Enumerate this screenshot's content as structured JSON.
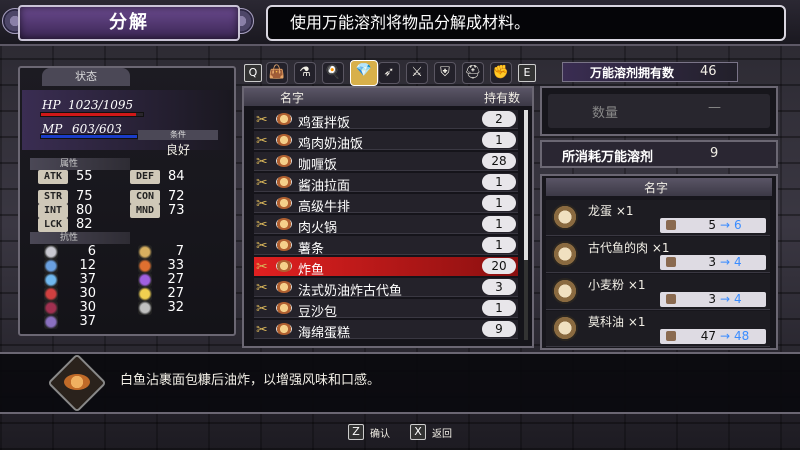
{
  "header": {
    "title": "分解",
    "hint": "使用万能溶剂将物品分解成材料。"
  },
  "status": {
    "tab": "状态",
    "hp_label": "HP",
    "hp_value": "1023/1095",
    "hp_fill": 0.93,
    "mp_label": "MP",
    "mp_value": "603/603",
    "mp_fill": 1.0,
    "condition_label": "条件",
    "condition_value": "良好",
    "attr_header": "属性",
    "stats": [
      {
        "label": "ATK",
        "value": "55"
      },
      {
        "label": "DEF",
        "value": "84"
      },
      {
        "label": "STR",
        "value": "75"
      },
      {
        "label": "CON",
        "value": "72"
      },
      {
        "label": "INT",
        "value": "80"
      },
      {
        "label": "MND",
        "value": "73"
      },
      {
        "label": "LCK",
        "value": "82"
      }
    ],
    "res_header": "抗性",
    "resistances": [
      {
        "icon": "slash-icon",
        "value": "6",
        "color": "#c8c8d0"
      },
      {
        "icon": "strike-icon",
        "value": "7",
        "color": "#d8b060"
      },
      {
        "icon": "pierce-icon",
        "value": "12",
        "color": "#6aa0e0"
      },
      {
        "icon": "fire-icon",
        "value": "33",
        "color": "#e07030"
      },
      {
        "icon": "ice-icon",
        "value": "37",
        "color": "#70b8f0"
      },
      {
        "icon": "thunder-icon",
        "value": "27",
        "color": "#a060e0"
      },
      {
        "icon": "dark-icon",
        "value": "30",
        "color": "#d04040"
      },
      {
        "icon": "light-icon",
        "value": "27",
        "color": "#f0d050"
      },
      {
        "icon": "curse-icon",
        "value": "30",
        "color": "#a03050"
      },
      {
        "icon": "petrify-icon",
        "value": "32",
        "color": "#c0c0c0"
      },
      {
        "icon": "poison-icon",
        "value": "37",
        "color": "#8a70c0"
      }
    ]
  },
  "tabs": {
    "left_key": "Q",
    "right_key": "E",
    "icons": [
      "bag-icon",
      "potion-icon",
      "food-icon",
      "gem-icon",
      "bow-icon",
      "sword-icon",
      "armor-icon",
      "helmet-icon",
      "gauntlet-icon"
    ],
    "active_index": 3
  },
  "list": {
    "col_name": "名字",
    "col_qty": "持有数",
    "selected_index": 7,
    "items": [
      {
        "name": "鸡蛋拌饭",
        "qty": "2"
      },
      {
        "name": "鸡肉奶油饭",
        "qty": "1"
      },
      {
        "name": "咖喱饭",
        "qty": "28"
      },
      {
        "name": "酱油拉面",
        "qty": "1"
      },
      {
        "name": "高级牛排",
        "qty": "1"
      },
      {
        "name": "肉火锅",
        "qty": "1"
      },
      {
        "name": "薯条",
        "qty": "1"
      },
      {
        "name": "炸鱼",
        "qty": "20"
      },
      {
        "name": "法式奶油炸古代鱼",
        "qty": "3"
      },
      {
        "name": "豆沙包",
        "qty": "1"
      },
      {
        "name": "海绵蛋糕",
        "qty": "9"
      }
    ]
  },
  "solvent": {
    "own_label": "万能溶剂拥有数",
    "own_value": "46",
    "qty_label": "数量",
    "qty_value": "—",
    "cost_label": "所消耗万能溶剂",
    "cost_value": "9"
  },
  "materials": {
    "header": "名字",
    "arrow": "→",
    "items": [
      {
        "name": "龙蛋 ×1",
        "from": "5",
        "to": "6"
      },
      {
        "name": "古代鱼的肉 ×1",
        "from": "3",
        "to": "4"
      },
      {
        "name": "小麦粉 ×1",
        "from": "3",
        "to": "4"
      },
      {
        "name": "莫科油 ×1",
        "from": "47",
        "to": "48"
      }
    ]
  },
  "description": "白鱼沾裹面包糠后油炸，以增强风味和口感。",
  "controls": {
    "confirm_key": "Z",
    "confirm_label": "确认",
    "back_key": "X",
    "back_label": "返回"
  },
  "colors": {
    "accent_purple": "#4b2d6e",
    "selected_row": "#b01818",
    "arrow_blue": "#3a8cff"
  }
}
